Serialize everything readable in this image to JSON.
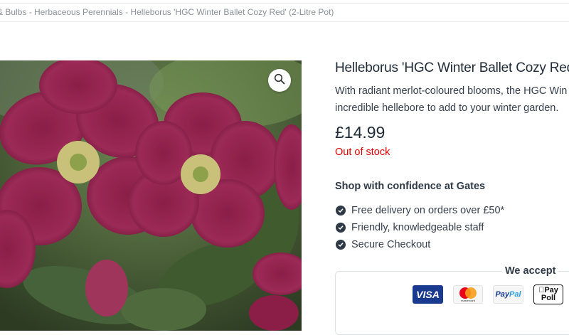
{
  "breadcrumb": {
    "text": "& Bulbs - Herbaceous Perennials - Helleborus 'HGC Winter Ballet Cozy Red' (2-Litre Pot)"
  },
  "product": {
    "title": "Helleborus 'HGC Winter Ballet Cozy Red' (",
    "description_lines": [
      "With radiant merlot-coloured blooms, the HGC Win",
      "incredible hellebore to add to your winter garden."
    ],
    "price": "£14.99",
    "stock_status": "Out of stock",
    "image_icon": "zoom-magnifier-icon"
  },
  "confidence": {
    "title": "Shop with confidence at Gates",
    "items": [
      "Free delivery on orders over £50*",
      "Friendly, knowledgeable staff",
      "Secure Checkout"
    ]
  },
  "payments": {
    "label": "We accept",
    "visa": "VISA",
    "mastercard": "mastercard",
    "paypal_a": "Pay",
    "paypal_b": "Pal",
    "applepay_a": "Pay",
    "applepay_b": "Poll"
  },
  "colors": {
    "stock_red": "#e00000",
    "text_dark": "#1f2a37",
    "visa_blue": "#1a3a8f"
  }
}
